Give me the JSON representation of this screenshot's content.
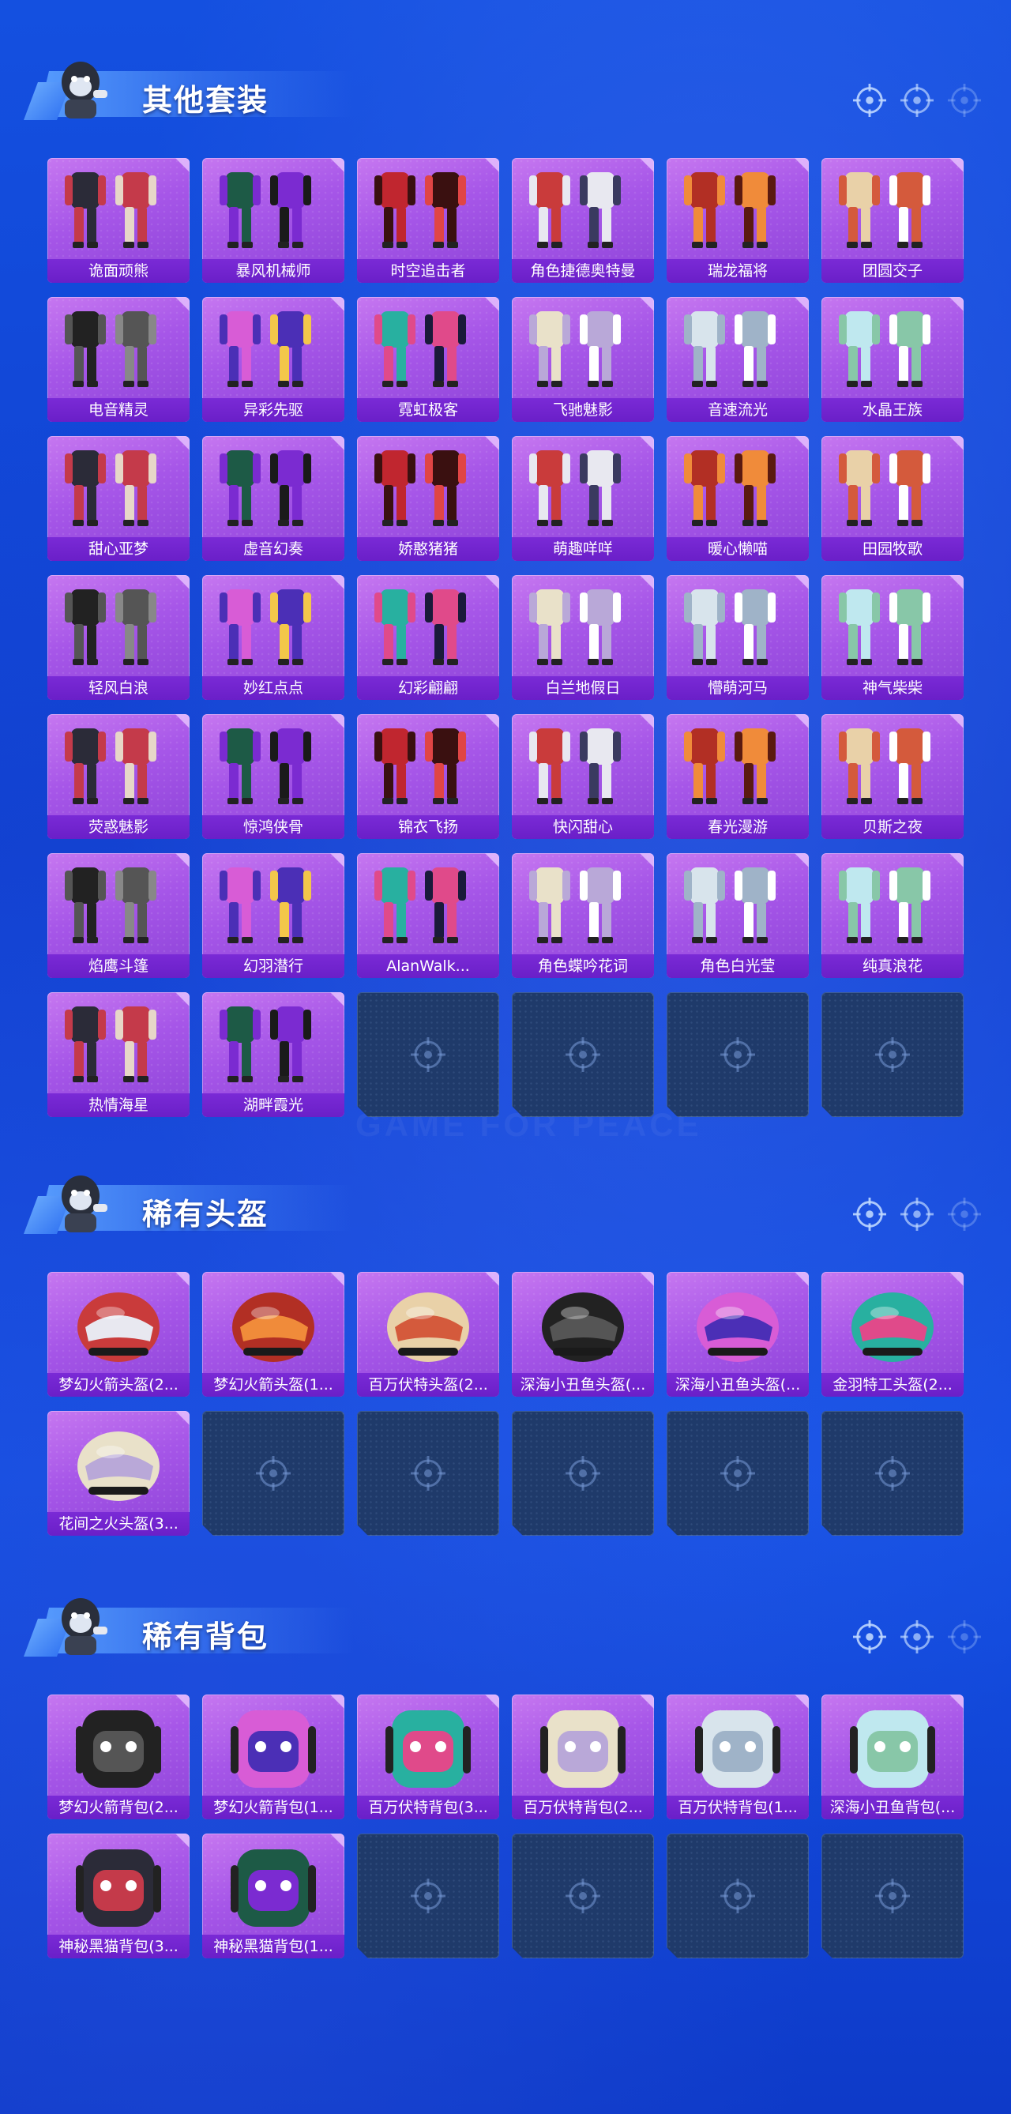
{
  "sections": [
    {
      "title": "其他套装",
      "items": [
        "诡面顽熊",
        "暴风机械师",
        "时空追击者",
        "角色捷德奥特曼",
        "瑞龙福将",
        "团圆交子",
        "电音精灵",
        "异彩先驱",
        "霓虹极客",
        "飞驰魅影",
        "音速流光",
        "水晶王族",
        "甜心亚梦",
        "虚音幻奏",
        "娇憨猪猪",
        "萌趣咩咩",
        "暖心懒喵",
        "田园牧歌",
        "轻风白浪",
        "妙红点点",
        "幻彩翩翩",
        "白兰地假日",
        "懵萌河马",
        "神气柴柴",
        "荧惑魅影",
        "惊鸿侠骨",
        "锦衣飞扬",
        "快闪甜心",
        "春光漫游",
        "贝斯之夜",
        "焰鹰斗篷",
        "幻羽潜行",
        "AlanWalk...",
        "角色蝶吟花词",
        "角色白光莹",
        "纯真浪花",
        "热情海星",
        "湖畔霞光"
      ],
      "empty_count": 4
    },
    {
      "title": "稀有头盔",
      "items": [
        "梦幻火箭头盔(2...",
        "梦幻火箭头盔(1...",
        "百万伏特头盔(2...",
        "深海小丑鱼头盔(...",
        "深海小丑鱼头盔(...",
        "金羽特工头盔(2...",
        "花间之火头盔(3..."
      ],
      "empty_count": 5
    },
    {
      "title": "稀有背包",
      "items": [
        "梦幻火箭背包(2...",
        "梦幻火箭背包(1...",
        "百万伏特背包(3...",
        "百万伏特背包(2...",
        "百万伏特背包(1...",
        "深海小丑鱼背包(...",
        "神秘黑猫背包(3...",
        "神秘黑猫背包(1..."
      ],
      "empty_count": 4
    }
  ],
  "watermark": "GAME FOR PEACE"
}
